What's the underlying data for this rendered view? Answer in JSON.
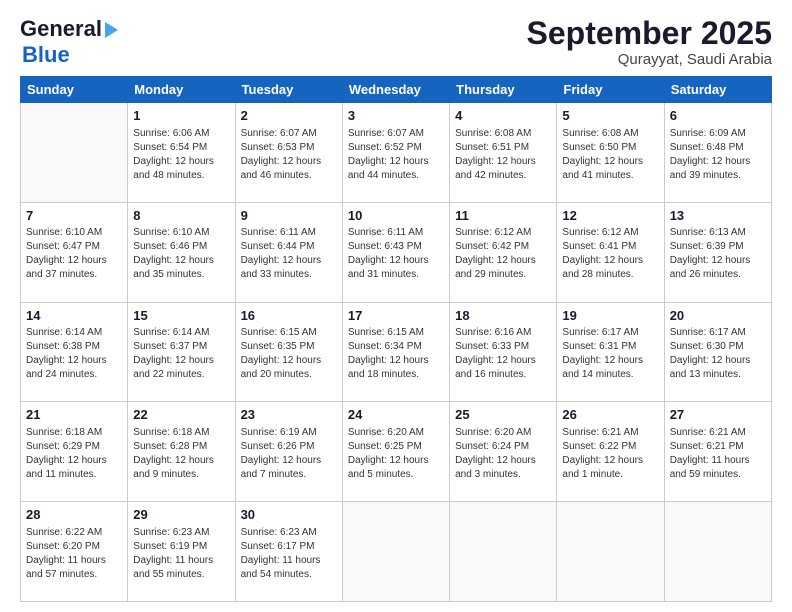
{
  "header": {
    "logo_line1": "General",
    "logo_line2": "Blue",
    "month": "September 2025",
    "location": "Qurayyat, Saudi Arabia"
  },
  "days_of_week": [
    "Sunday",
    "Monday",
    "Tuesday",
    "Wednesday",
    "Thursday",
    "Friday",
    "Saturday"
  ],
  "weeks": [
    [
      {
        "day": "",
        "info": ""
      },
      {
        "day": "1",
        "info": "Sunrise: 6:06 AM\nSunset: 6:54 PM\nDaylight: 12 hours\nand 48 minutes."
      },
      {
        "day": "2",
        "info": "Sunrise: 6:07 AM\nSunset: 6:53 PM\nDaylight: 12 hours\nand 46 minutes."
      },
      {
        "day": "3",
        "info": "Sunrise: 6:07 AM\nSunset: 6:52 PM\nDaylight: 12 hours\nand 44 minutes."
      },
      {
        "day": "4",
        "info": "Sunrise: 6:08 AM\nSunset: 6:51 PM\nDaylight: 12 hours\nand 42 minutes."
      },
      {
        "day": "5",
        "info": "Sunrise: 6:08 AM\nSunset: 6:50 PM\nDaylight: 12 hours\nand 41 minutes."
      },
      {
        "day": "6",
        "info": "Sunrise: 6:09 AM\nSunset: 6:48 PM\nDaylight: 12 hours\nand 39 minutes."
      }
    ],
    [
      {
        "day": "7",
        "info": "Sunrise: 6:10 AM\nSunset: 6:47 PM\nDaylight: 12 hours\nand 37 minutes."
      },
      {
        "day": "8",
        "info": "Sunrise: 6:10 AM\nSunset: 6:46 PM\nDaylight: 12 hours\nand 35 minutes."
      },
      {
        "day": "9",
        "info": "Sunrise: 6:11 AM\nSunset: 6:44 PM\nDaylight: 12 hours\nand 33 minutes."
      },
      {
        "day": "10",
        "info": "Sunrise: 6:11 AM\nSunset: 6:43 PM\nDaylight: 12 hours\nand 31 minutes."
      },
      {
        "day": "11",
        "info": "Sunrise: 6:12 AM\nSunset: 6:42 PM\nDaylight: 12 hours\nand 29 minutes."
      },
      {
        "day": "12",
        "info": "Sunrise: 6:12 AM\nSunset: 6:41 PM\nDaylight: 12 hours\nand 28 minutes."
      },
      {
        "day": "13",
        "info": "Sunrise: 6:13 AM\nSunset: 6:39 PM\nDaylight: 12 hours\nand 26 minutes."
      }
    ],
    [
      {
        "day": "14",
        "info": "Sunrise: 6:14 AM\nSunset: 6:38 PM\nDaylight: 12 hours\nand 24 minutes."
      },
      {
        "day": "15",
        "info": "Sunrise: 6:14 AM\nSunset: 6:37 PM\nDaylight: 12 hours\nand 22 minutes."
      },
      {
        "day": "16",
        "info": "Sunrise: 6:15 AM\nSunset: 6:35 PM\nDaylight: 12 hours\nand 20 minutes."
      },
      {
        "day": "17",
        "info": "Sunrise: 6:15 AM\nSunset: 6:34 PM\nDaylight: 12 hours\nand 18 minutes."
      },
      {
        "day": "18",
        "info": "Sunrise: 6:16 AM\nSunset: 6:33 PM\nDaylight: 12 hours\nand 16 minutes."
      },
      {
        "day": "19",
        "info": "Sunrise: 6:17 AM\nSunset: 6:31 PM\nDaylight: 12 hours\nand 14 minutes."
      },
      {
        "day": "20",
        "info": "Sunrise: 6:17 AM\nSunset: 6:30 PM\nDaylight: 12 hours\nand 13 minutes."
      }
    ],
    [
      {
        "day": "21",
        "info": "Sunrise: 6:18 AM\nSunset: 6:29 PM\nDaylight: 12 hours\nand 11 minutes."
      },
      {
        "day": "22",
        "info": "Sunrise: 6:18 AM\nSunset: 6:28 PM\nDaylight: 12 hours\nand 9 minutes."
      },
      {
        "day": "23",
        "info": "Sunrise: 6:19 AM\nSunset: 6:26 PM\nDaylight: 12 hours\nand 7 minutes."
      },
      {
        "day": "24",
        "info": "Sunrise: 6:20 AM\nSunset: 6:25 PM\nDaylight: 12 hours\nand 5 minutes."
      },
      {
        "day": "25",
        "info": "Sunrise: 6:20 AM\nSunset: 6:24 PM\nDaylight: 12 hours\nand 3 minutes."
      },
      {
        "day": "26",
        "info": "Sunrise: 6:21 AM\nSunset: 6:22 PM\nDaylight: 12 hours\nand 1 minute."
      },
      {
        "day": "27",
        "info": "Sunrise: 6:21 AM\nSunset: 6:21 PM\nDaylight: 11 hours\nand 59 minutes."
      }
    ],
    [
      {
        "day": "28",
        "info": "Sunrise: 6:22 AM\nSunset: 6:20 PM\nDaylight: 11 hours\nand 57 minutes."
      },
      {
        "day": "29",
        "info": "Sunrise: 6:23 AM\nSunset: 6:19 PM\nDaylight: 11 hours\nand 55 minutes."
      },
      {
        "day": "30",
        "info": "Sunrise: 6:23 AM\nSunset: 6:17 PM\nDaylight: 11 hours\nand 54 minutes."
      },
      {
        "day": "",
        "info": ""
      },
      {
        "day": "",
        "info": ""
      },
      {
        "day": "",
        "info": ""
      },
      {
        "day": "",
        "info": ""
      }
    ]
  ]
}
